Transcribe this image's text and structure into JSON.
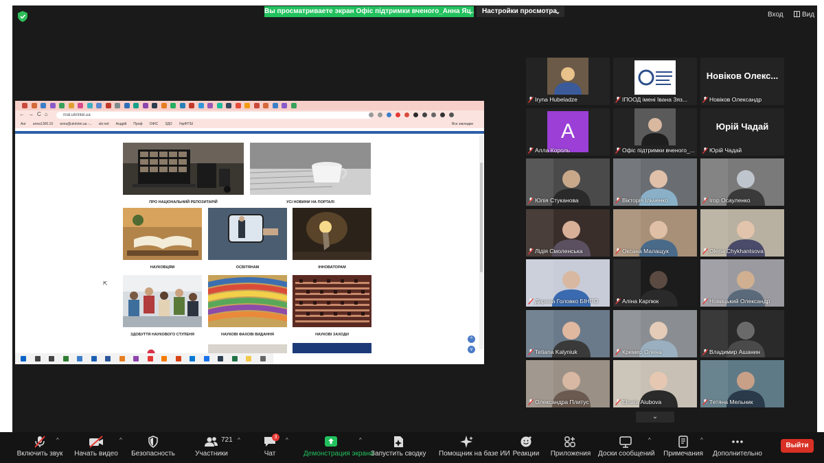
{
  "top_bar": {
    "share_banner": "Вы просматриваете экран Офіс підтримки вченого_Анна Яц...",
    "view_settings": "Настройки просмотра",
    "exit_label": "Вход",
    "view_label": "Вид"
  },
  "shared_screen": {
    "address": "nrat.ukrintei.ua",
    "bookmarks": [
      "Анг",
      "anna1300.10",
      "anna@ukrintei.ua -...",
      "ukr.net",
      "Андрій",
      "Проф",
      "ОФІС",
      "ЗДО",
      "УкрІНТЕІ"
    ],
    "bookmarks_right": "Все закладки",
    "cards": [
      {
        "caption": "ПРО НАЦІОНАЛЬНИЙ РЕПОЗИТАРІЙ"
      },
      {
        "caption": "УСІ НОВИНИ НА ПОРТАЛІ"
      },
      {
        "caption": "НАУКОВЦЯМ"
      },
      {
        "caption": "ОСВІТЯНАМ"
      },
      {
        "caption": "ІННОВАТОРАМ"
      },
      {
        "caption": "ЗДОБУТТЯ НАУКОВОГО СТУПЕНЯ"
      },
      {
        "caption": "НАУКОВІ ФАХОВІ ВИДАННЯ"
      },
      {
        "caption": "НАУКОВІ ЗАХОДИ"
      }
    ]
  },
  "participants": [
    {
      "name": "Iryna Hubeladze",
      "type": "video"
    },
    {
      "name": "ІПООД імені Івана Зяз...",
      "type": "logo"
    },
    {
      "name": "Новіков Олександр",
      "type": "text",
      "big": "Новіков Олекс..."
    },
    {
      "name": "Алла Король",
      "type": "avatar",
      "initial": "A"
    },
    {
      "name": "Офіс підтримки вченого_...",
      "type": "video",
      "active": true
    },
    {
      "name": "Юрій Чадай",
      "type": "text",
      "big": "Юрій Чадай"
    },
    {
      "name": "Юлія Стуканова",
      "type": "video"
    },
    {
      "name": "Вікторія Ільченко",
      "type": "video"
    },
    {
      "name": "Ігор Осауленко",
      "type": "video"
    },
    {
      "name": "Лідія Смоленська",
      "type": "video"
    },
    {
      "name": "Оксана Малащук",
      "type": "video"
    },
    {
      "name": "Olena Chykhantsova",
      "type": "video"
    },
    {
      "name": "Дарина Головко БІНПО",
      "type": "video"
    },
    {
      "name": "Аліна Карпюк",
      "type": "video"
    },
    {
      "name": "Новицький Олександр",
      "type": "video"
    },
    {
      "name": "Tetiana Kalyniuk",
      "type": "video"
    },
    {
      "name": "Кремер Олена",
      "type": "video"
    },
    {
      "name": "Владимир Ашанин",
      "type": "video"
    },
    {
      "name": "Олександра Плитус",
      "type": "video"
    },
    {
      "name": "Elnara Aiubova",
      "type": "video"
    },
    {
      "name": "Тетяна Мельник",
      "type": "video"
    }
  ],
  "controls": {
    "audio": "Включить звук",
    "video": "Начать видео",
    "security": "Безопасность",
    "participants": "Участники",
    "participants_count": "721",
    "chat": "Чат",
    "chat_badge": "3",
    "share": "Демонстрация экрана",
    "summary": "Запустить сводку",
    "ai": "Помощник на базе ИИ",
    "reactions": "Реакции",
    "apps": "Приложения",
    "whiteboards": "Доски сообщений",
    "notes": "Примечания",
    "more": "Дополнительно",
    "leave": "Выйти"
  },
  "colors": {
    "share_green": "#22c15e",
    "active_speaker": "#d8d24a",
    "leave_red": "#d93025",
    "muted_red": "#e53935"
  }
}
